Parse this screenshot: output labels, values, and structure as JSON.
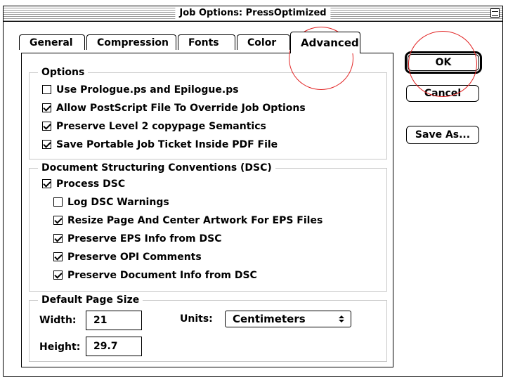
{
  "window": {
    "title": "Job Options: PressOptimized"
  },
  "tabs": [
    {
      "label": "General"
    },
    {
      "label": "Compression"
    },
    {
      "label": "Fonts"
    },
    {
      "label": "Color"
    },
    {
      "label": "Advanced",
      "active": true
    }
  ],
  "options": {
    "title": "Options",
    "items": [
      {
        "label": "Use Prologue.ps and Epilogue.ps",
        "checked": false
      },
      {
        "label": "Allow PostScript File To Override Job Options",
        "checked": true
      },
      {
        "label": "Preserve Level 2 copypage Semantics",
        "checked": true
      },
      {
        "label": "Save Portable Job Ticket Inside PDF File",
        "checked": true
      }
    ]
  },
  "dsc": {
    "title": "Document Structuring Conventions (DSC)",
    "process": {
      "label": "Process DSC",
      "checked": true
    },
    "items": [
      {
        "label": "Log DSC Warnings",
        "checked": false
      },
      {
        "label": "Resize Page And Center Artwork For EPS Files",
        "checked": true
      },
      {
        "label": "Preserve EPS Info from DSC",
        "checked": true
      },
      {
        "label": "Preserve OPI Comments",
        "checked": true
      },
      {
        "label": "Preserve Document Info from DSC",
        "checked": true
      }
    ]
  },
  "page_size": {
    "title": "Default Page Size",
    "width_label": "Width:",
    "width_value": "21",
    "height_label": "Height:",
    "height_value": "29.7",
    "units_label": "Units:",
    "units_value": "Centimeters"
  },
  "buttons": {
    "ok": "OK",
    "cancel": "Cancel",
    "save_as": "Save As..."
  },
  "annotation_color": "#e12121"
}
